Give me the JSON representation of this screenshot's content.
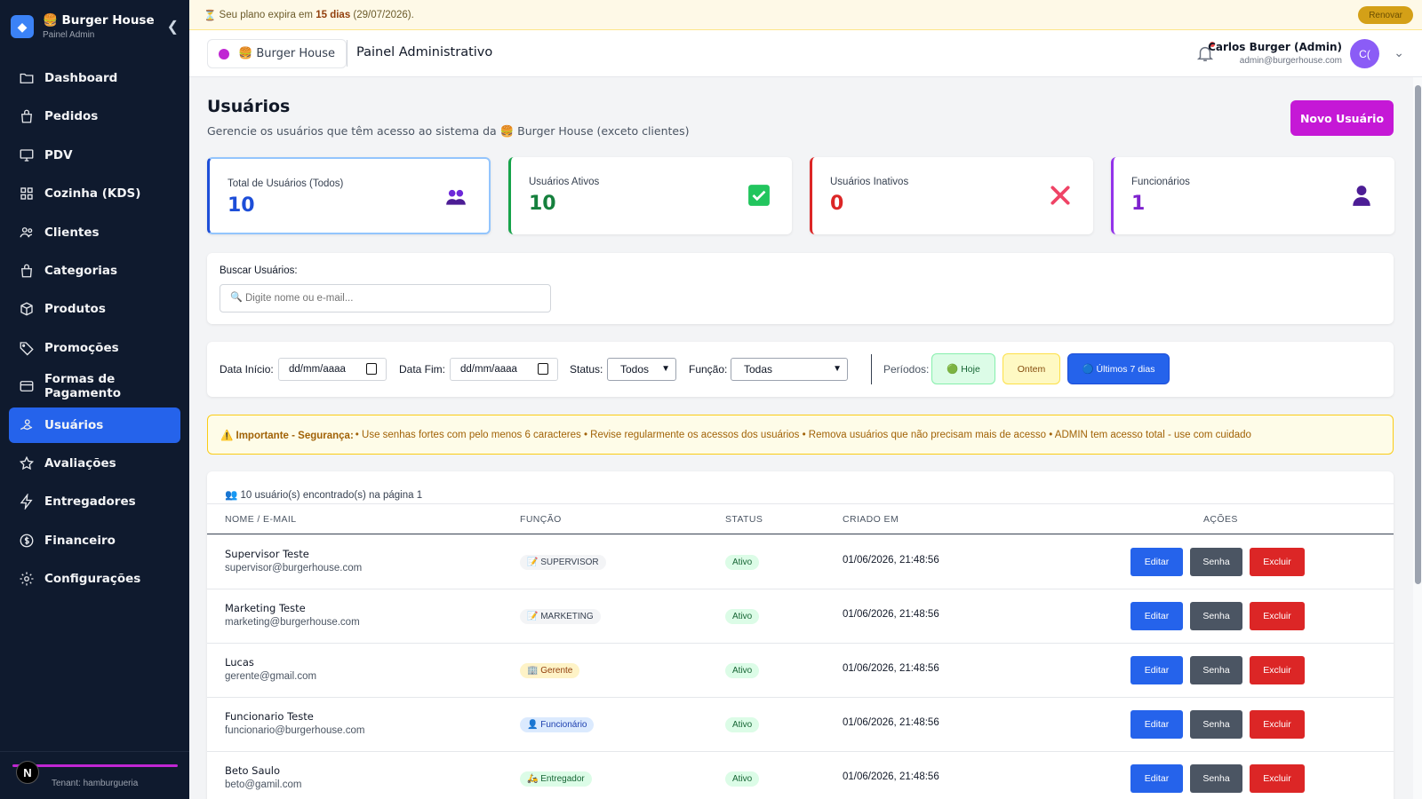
{
  "plan_banner": {
    "icon": "⏳",
    "prefix": "Seu plano expira em",
    "days": "15 dias",
    "date": "(29/07/2026).",
    "renew_label": "Renovar"
  },
  "sidebar": {
    "brand": "🍔 Burger House",
    "subtitle": "Painel Admin",
    "items": [
      {
        "label": "Dashboard",
        "icon": "folder-icon"
      },
      {
        "label": "Pedidos",
        "icon": "bag-icon"
      },
      {
        "label": "PDV",
        "icon": "monitor-icon"
      },
      {
        "label": "Cozinha (KDS)",
        "icon": "grid-icon"
      },
      {
        "label": "Clientes",
        "icon": "users-icon"
      },
      {
        "label": "Categorias",
        "icon": "bag-icon"
      },
      {
        "label": "Produtos",
        "icon": "box-icon"
      },
      {
        "label": "Promoções",
        "icon": "tag-icon"
      },
      {
        "label": "Formas de Pagamento",
        "icon": "card-icon"
      },
      {
        "label": "Usuários",
        "icon": "user-hand-icon"
      },
      {
        "label": "Avaliações",
        "icon": "star-icon"
      },
      {
        "label": "Entregadores",
        "icon": "bolt-icon"
      },
      {
        "label": "Financeiro",
        "icon": "dollar-icon"
      },
      {
        "label": "Configurações",
        "icon": "gear-icon"
      }
    ],
    "active_index": 9,
    "avatar_letter": "N",
    "tenant": "Tenant: hamburgueria"
  },
  "header": {
    "brand_chip": "🍔 Burger House",
    "title": "Painel Administrativo",
    "user_name": "Carlos Burger (Admin)",
    "user_email": "admin@burgerhouse.com",
    "avatar_initials": "C("
  },
  "page": {
    "title": "Usuários",
    "description": "Gerencie os usuários que têm acesso ao sistema da 🍔 Burger House (exceto clientes)",
    "new_button": "Novo Usuário"
  },
  "stats": [
    {
      "label": "Total de Usuários (Todos)",
      "value": "10",
      "color": "#1d4ed8",
      "icon": "users-icon"
    },
    {
      "label": "Usuários Ativos",
      "value": "10",
      "color": "#15803d",
      "icon": "check-icon"
    },
    {
      "label": "Usuários Inativos",
      "value": "0",
      "color": "#dc2626",
      "icon": "x-icon"
    },
    {
      "label": "Funcionários",
      "value": "1",
      "color": "#7e22ce",
      "icon": "person-icon"
    }
  ],
  "search": {
    "label": "Buscar Usuários:",
    "placeholder": "Digite nome ou e-mail..."
  },
  "filters": {
    "start_label": "Data Início:",
    "start_value": "dd/mm/aaaa",
    "end_label": "Data Fim:",
    "end_value": "dd/mm/aaaa",
    "status_label": "Status:",
    "status_value": "Todos",
    "role_label": "Função:",
    "role_value": "Todas",
    "periods_label": "Períodos:",
    "periods": [
      "🟢 Hoje",
      "Ontem",
      "🔵 Últimos 7 dias"
    ]
  },
  "warning": {
    "title": "⚠️ Importante - Segurança:",
    "text": "• Use senhas fortes com pelo menos 6 caracteres • Revise regularmente os acessos dos usuários • Remova usuários que não precisam mais de acesso • ADMIN tem acesso total - use com cuidado"
  },
  "table": {
    "summary": "10 usuário(s) encontrado(s) na página 1",
    "columns": [
      "NOME / E-MAIL",
      "FUNÇÃO",
      "STATUS",
      "CRIADO EM",
      "AÇÕES"
    ],
    "actions": [
      "Editar",
      "Senha",
      "Excluir"
    ],
    "rows": [
      {
        "name": "Supervisor Teste",
        "email": "supervisor@burgerhouse.com",
        "role": "📝 SUPERVISOR",
        "status": "Ativo",
        "created": "01/06/2026, 21:48:56"
      },
      {
        "name": "Marketing Teste",
        "email": "marketing@burgerhouse.com",
        "role": "📝 MARKETING",
        "status": "Ativo",
        "created": "01/06/2026, 21:48:56"
      },
      {
        "name": "Lucas",
        "email": "gerente@gmail.com",
        "role": "🏢 Gerente",
        "status": "Ativo",
        "created": "01/06/2026, 21:48:56"
      },
      {
        "name": "Funcionario Teste",
        "email": "funcionario@burgerhouse.com",
        "role": "👤 Funcionário",
        "status": "Ativo",
        "created": "01/06/2026, 21:48:56"
      },
      {
        "name": "Beto Saulo",
        "email": "beto@gamil.com",
        "role": "🛵 Entregador",
        "status": "Ativo",
        "created": "01/06/2026, 21:48:56"
      }
    ]
  }
}
